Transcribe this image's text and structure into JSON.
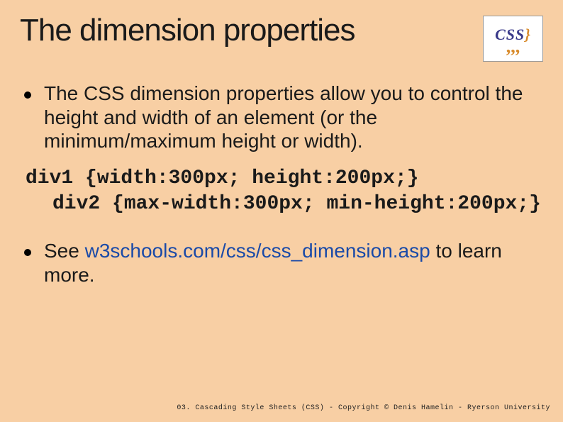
{
  "title": "The dimension properties",
  "logo": {
    "text_main": "CSS",
    "brace": "}",
    "commas": ",,,"
  },
  "bullets": [
    "The CSS dimension properties allow you to control the height and width of an element (or the minimum/maximum height or width)."
  ],
  "code": {
    "line1": "div1 {width:300px; height:200px;}",
    "line2": "div2 {max-width:300px; min-height:200px;}"
  },
  "bullet2_prefix": "See ",
  "bullet2_link": "w3schools.com/css/css_dimension.asp",
  "bullet2_suffix": " to learn more.",
  "footer": "03. Cascading Style Sheets (CSS) - Copyright © Denis Hamelin - Ryerson University"
}
